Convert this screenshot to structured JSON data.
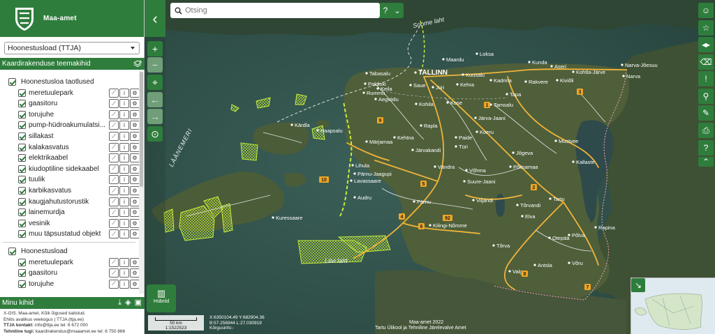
{
  "brand": {
    "name": "Maa-amet"
  },
  "layer_select": {
    "value": "Hoonestusload (TTJA)"
  },
  "theme_section": {
    "title": "Kaardirakenduse teemakihid"
  },
  "groups": [
    {
      "label": "Hoonestusloa taotlused",
      "checked": true,
      "layers": [
        "meretuulepark",
        "gaasitoru",
        "torujuhe",
        "pump-hüdroakumulatsi...",
        "sillakast",
        "kalakasvatus",
        "elektrikaabel",
        "kiudoptiline sidekaabel",
        "tuulik",
        "karbikasvatus",
        "kaugjahutustorustik",
        "lainemurdja",
        "vesinik",
        "muu täpsustatud objekt"
      ]
    },
    {
      "label": "Hoonestusload",
      "checked": true,
      "layers": [
        "meretuulepark",
        "gaasitoru",
        "torujuhe"
      ]
    }
  ],
  "layer_buttons": {
    "legend_icon": "chart-icon",
    "info_label": "i",
    "settings_icon": "gear-icon"
  },
  "my_layers": {
    "title": "Minu kihid"
  },
  "footer": {
    "line1": "X-GIS. Maa-amet. Kõik õigused kaitstud.",
    "line2": "Ehitis avalikus veekogus | TTJA (ttja.ee)",
    "line3_label": "TTJA kontakt:",
    "line3_value": "info@ttja.ee tel: 6 672 000",
    "line4_label": "Tehniline tugi:",
    "line4_value": "kaardirakendus@maaamet.ee tel: 6 750 866"
  },
  "search": {
    "placeholder": "Otsing",
    "help": "?"
  },
  "map_buttons": {
    "hybrid_label": "Hübriid"
  },
  "scale": {
    "distance": "50 km",
    "ratio": "1:1522523"
  },
  "coords": {
    "xy": "X:6350104.49 Y:682904.36",
    "bl": "B:57.256944 L:27.030919",
    "height": "Kõrgusinfo:-"
  },
  "attribution": {
    "line1": "Maa-amet 2022",
    "line2": "Tartu Ülikool ja Tehniline Järelevalve Amet"
  },
  "map_labels": {
    "sea_gulf": "Soome laht",
    "sea_west": "LÄÄNEMERI",
    "sea_riga": "Liivi laht",
    "cities": [
      "TALLINN",
      "Loksa",
      "Kunda",
      "Aseri",
      "Kohtla-Järve",
      "Narva-Jõesuu",
      "Narva",
      "Kiviõli",
      "Rakvere",
      "Tapa",
      "Kehra",
      "Kuusalu",
      "Kadrina",
      "Maardu",
      "Paldiski",
      "Saue",
      "Jüri",
      "Keila",
      "Kose",
      "Aegviidu",
      "Tamsalu",
      "Kohila",
      "Rapla",
      "Järva-Jaani",
      "Haapsalu",
      "Märjamaa",
      "Kehtna",
      "Türi",
      "Paide",
      "Koeru",
      "Mustvee",
      "Jõgeva",
      "Järvakandi",
      "Lihula",
      "Pärnu-Jaagupi",
      "Vändra",
      "Võhma",
      "Põltsamaa",
      "Kallaste",
      "Lavassaare",
      "Suure-Jaani",
      "Tartu",
      "Audru",
      "Pärnu",
      "Viljandi",
      "Tõrvandi",
      "Elva",
      "Kuressaare",
      "Kilingi-Nõmme",
      "Rapina",
      "Põlva",
      "Otepää",
      "Tõrva",
      "Antsla",
      "Võru",
      "Valga",
      "Kärdla",
      "Rummu",
      "Tabasalu"
    ]
  },
  "road_numbers": [
    "1",
    "2",
    "3",
    "4",
    "5",
    "6",
    "7",
    "8",
    "9",
    "10",
    "92"
  ],
  "colors": {
    "primary": "#2f7d3c",
    "accent": "#c7ee3a",
    "road": "#f0b43a"
  }
}
